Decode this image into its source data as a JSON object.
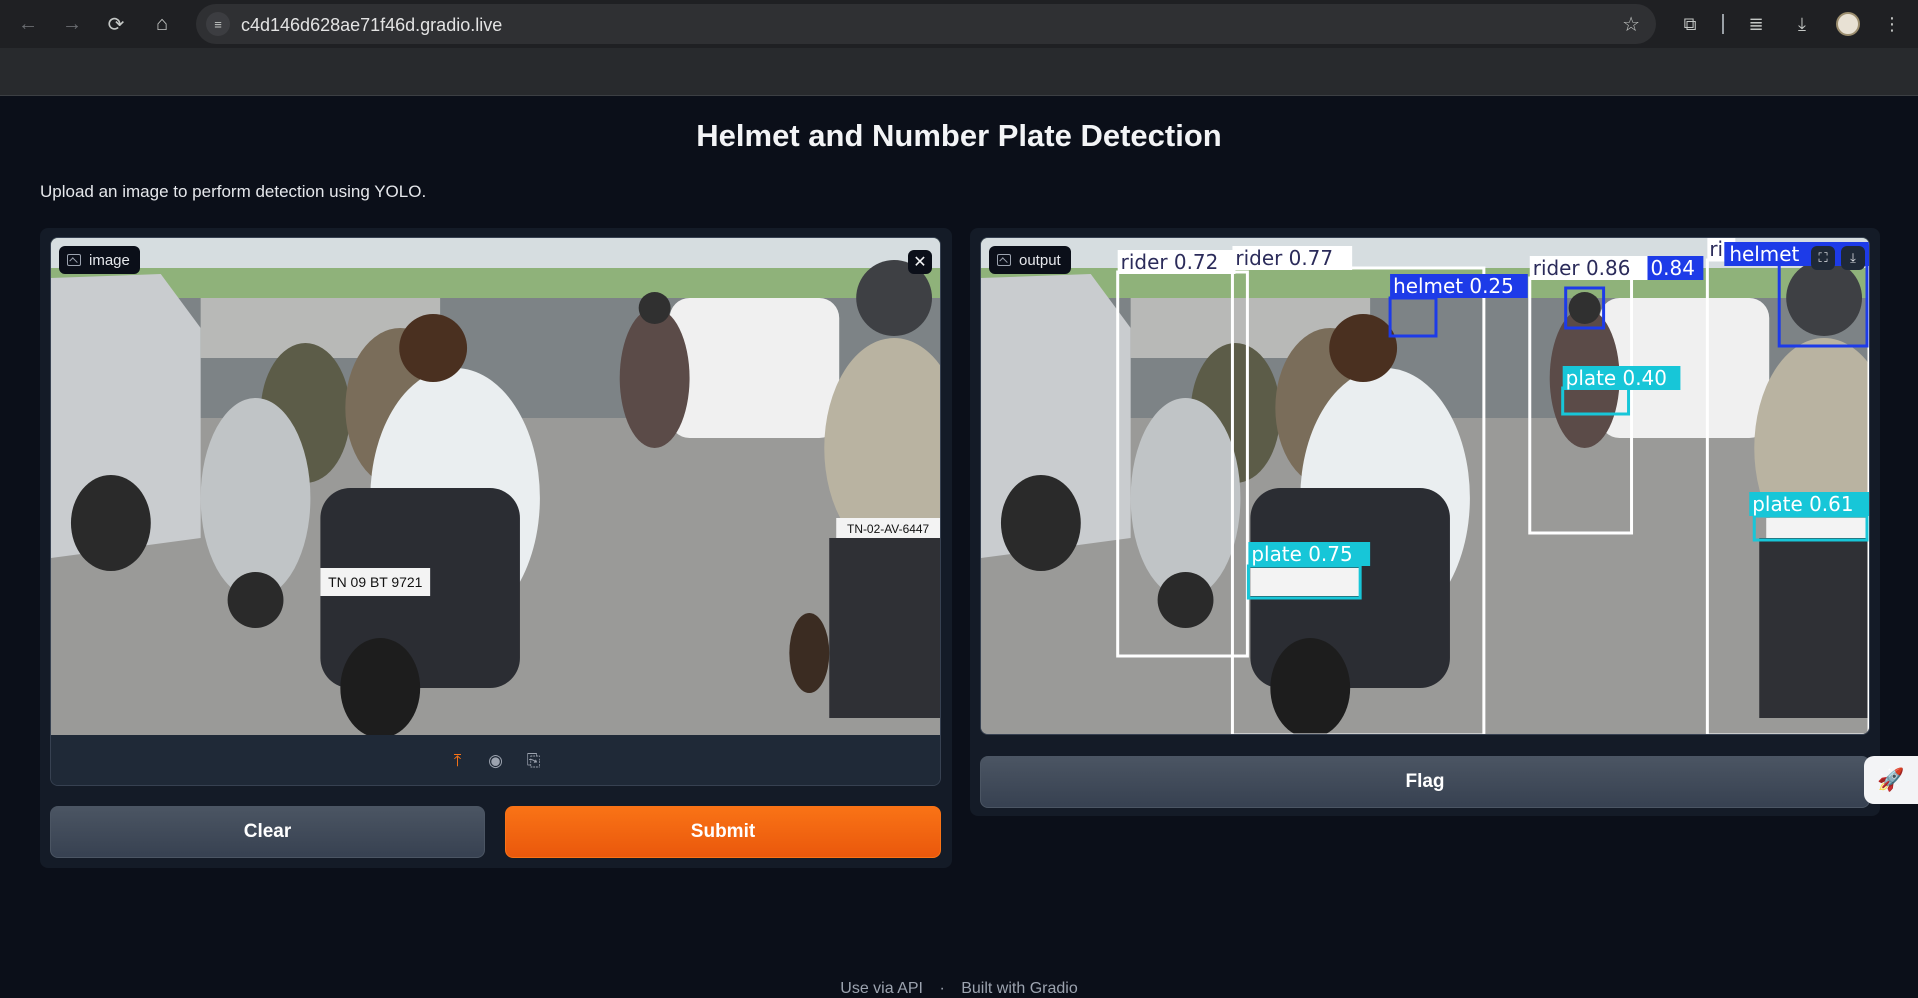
{
  "browser": {
    "url": "c4d146d628ae71f46d.gradio.live",
    "back_icon": "arrow-left",
    "forward_icon": "arrow-right",
    "reload_icon": "reload",
    "home_icon": "home"
  },
  "page": {
    "title": "Helmet and Number Plate Detection",
    "description": "Upload an image to perform detection using YOLO."
  },
  "input": {
    "label": "image",
    "sources": [
      "upload",
      "webcam",
      "clipboard"
    ],
    "active_source": "upload"
  },
  "output": {
    "label": "output",
    "detections": [
      {
        "label": "rider 0.72",
        "class": "rider"
      },
      {
        "label": "rider 0.77",
        "class": "rider"
      },
      {
        "label": "helmet 0.25",
        "class": "helmet"
      },
      {
        "label": "rider 0.86",
        "class": "rider"
      },
      {
        "label": "0.84",
        "class": "helmet"
      },
      {
        "label": "ri",
        "class": "rider"
      },
      {
        "label": "helmet",
        "class": "helmet"
      },
      {
        "label": "plate 0.40",
        "class": "plate"
      },
      {
        "label": "plate 0.61",
        "class": "plate"
      },
      {
        "label": "plate 0.75",
        "class": "plate"
      }
    ],
    "colors": {
      "rider": "#ffffff",
      "helmet": "#1d3be8",
      "plate": "#17c6d8"
    }
  },
  "buttons": {
    "clear": "Clear",
    "submit": "Submit",
    "flag": "Flag"
  },
  "plates": {
    "front": "TN 09 BT 9721",
    "right": "TN-02-AV-6447"
  },
  "footer": {
    "api": "Use via API",
    "separator": "·",
    "built": "Built with Gradio"
  },
  "colors": {
    "accent": "#f97316",
    "background": "#0b0f19",
    "panel": "#141b27"
  }
}
